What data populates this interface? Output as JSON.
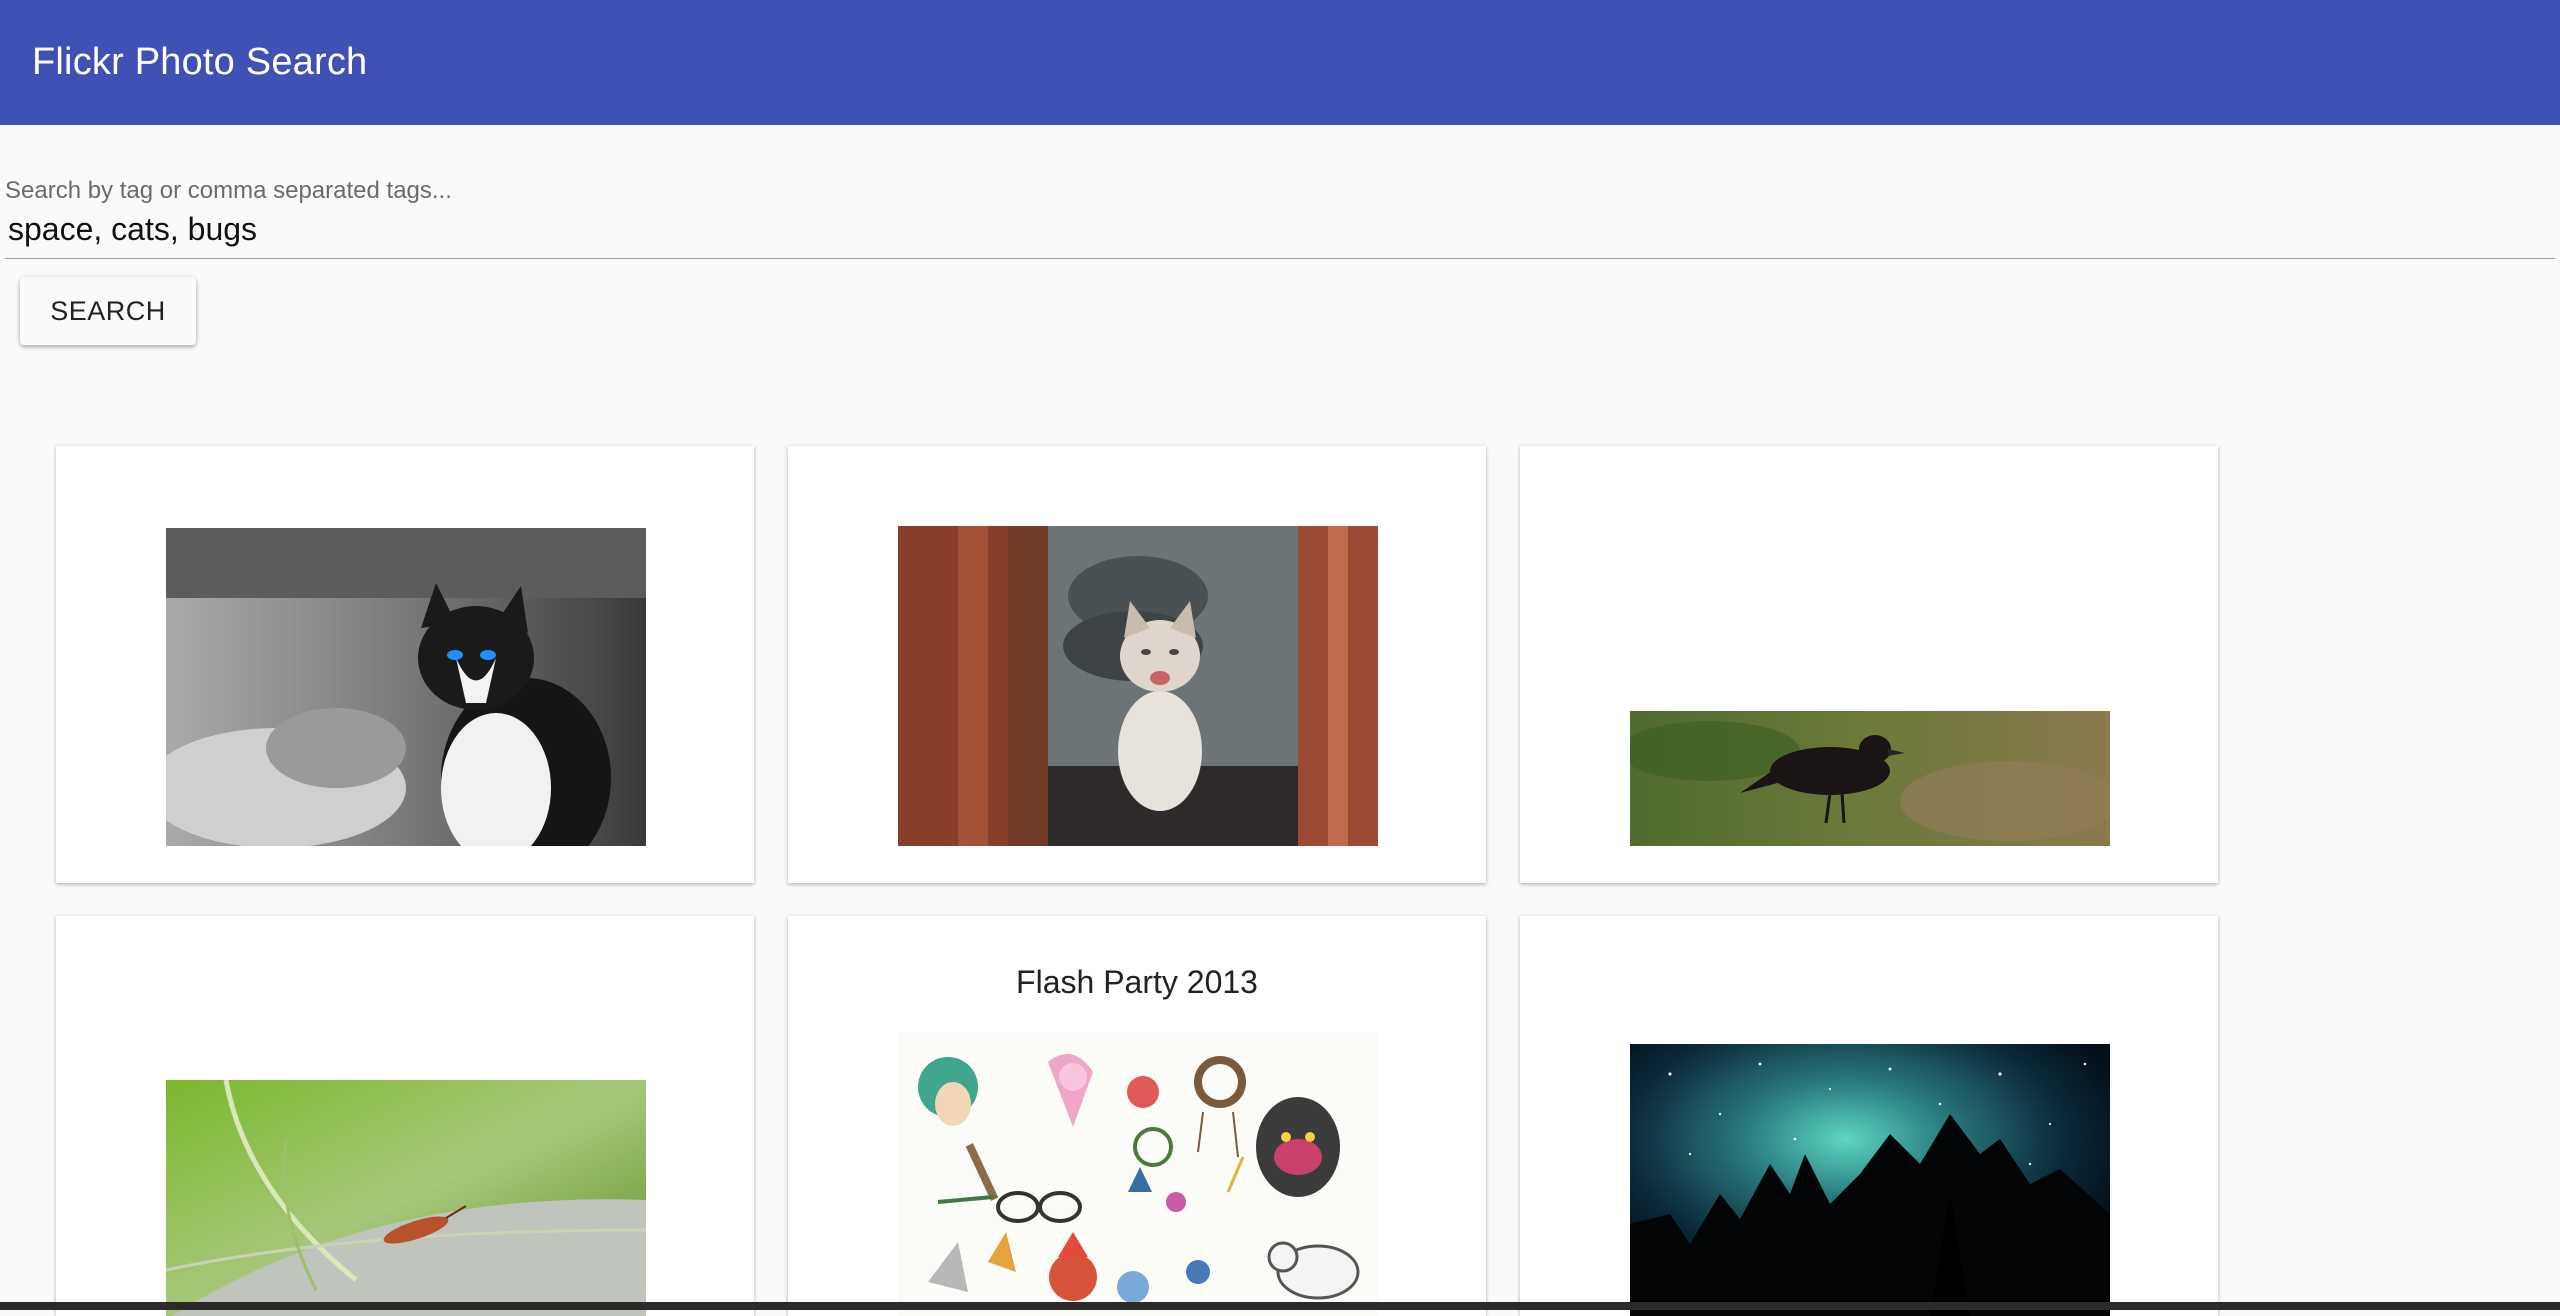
{
  "header": {
    "title": "Flickr Photo Search"
  },
  "search": {
    "label": "Search by tag or comma separated tags...",
    "value": "space, cats, bugs",
    "button_label": "SEARCH"
  },
  "cards": [
    {
      "title": "",
      "photo": "black-and-white cat with blue eyes"
    },
    {
      "title": "",
      "photo": "kitten sitting in red doorway"
    },
    {
      "title": "",
      "photo": "dark bird on grass"
    },
    {
      "title": "",
      "photo": "bug on green leaf"
    },
    {
      "title": "Flash Party 2013",
      "photo": "tattoo flash sticker sheet"
    },
    {
      "title": "",
      "photo": "night sky with stars and trees"
    }
  ],
  "colors": {
    "app_bar": "#3f51b5",
    "background": "#fafafa",
    "card": "#ffffff"
  }
}
